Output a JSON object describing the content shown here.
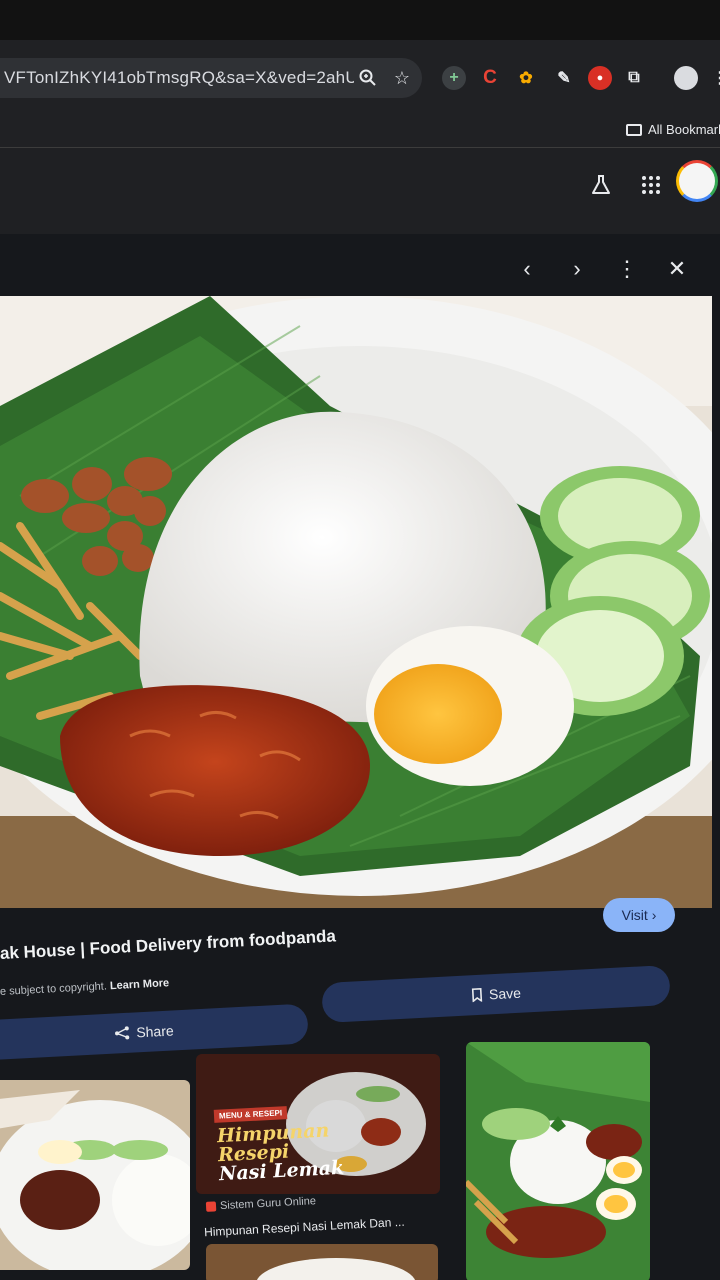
{
  "browser": {
    "url": "VFTonIZhKYI41obTmsgRQ&sa=X&ved=2ahUK...",
    "bookmarks_label": "All Bookmark"
  },
  "viewer": {
    "visit_label": "Visit",
    "title": "ak House | Food Delivery from foodpanda",
    "copyright_text": "e subject to copyright.",
    "learn_more": "Learn More",
    "save_label": "Save",
    "share_label": "Share"
  },
  "related": [
    {
      "badge": "MENU & RESEPI",
      "headline_line1": "Himpunan",
      "headline_line2": "Resepi",
      "headline_line3": "Nasi Lemak",
      "source": "Sistem Guru Online",
      "caption": "Himpunan Resepi Nasi Lemak Dan ..."
    }
  ],
  "colors": {
    "toolbar": "#202124",
    "accent_button": "#8ab4f8",
    "tonal_button": "#24345c"
  },
  "icons": [
    "search-icon",
    "star-icon",
    "labs-icon",
    "apps-grid-icon",
    "chevron-left-icon",
    "chevron-right-icon",
    "more-vert-icon",
    "close-icon",
    "bookmark-icon",
    "share-icon"
  ]
}
